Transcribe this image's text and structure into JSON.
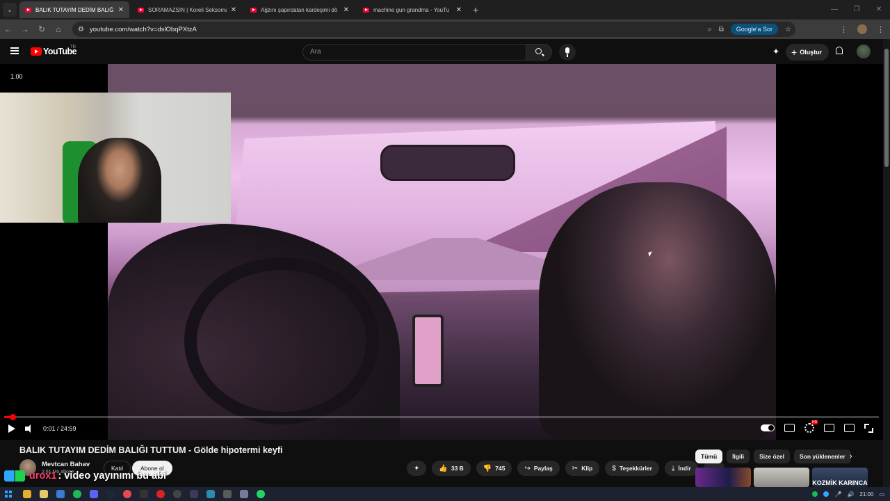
{
  "browser": {
    "tabs": [
      {
        "title": "BALIK TUTAYIM DEDİM BALIĞI",
        "active": true
      },
      {
        "title": "SORAMAZSIN | Koreli Seksoma",
        "active": false
      },
      {
        "title": "Ağzını şapırdatan kardeşimi dö",
        "active": false
      },
      {
        "title": "machine gun grandma - YouTu",
        "active": false
      }
    ],
    "url": "youtube.com/watch?v=dslObqPXtzA",
    "google_sor": "Google'a Sor"
  },
  "youtube": {
    "logo_text": "YouTube",
    "country": "TR",
    "search_placeholder": "Ara",
    "create_label": "Oluştur"
  },
  "player": {
    "speed": "1.00",
    "time": "0:01 / 24:59",
    "progress_fraction": 0.0007
  },
  "video": {
    "title": "BALIK TUTAYIM DEDİM BALIĞI TUTTUM - Gölde hipotermi keyfi",
    "channel": "Mevtcan Bahav",
    "subscribers": "2,61 Mn abone",
    "join_label": "Katıl",
    "subscribe_label": "Abone ol",
    "likes": "33 B",
    "dislikes": "745",
    "share_label": "Paylaş",
    "clip_label": "Klip",
    "thanks_label": "Teşekkürler",
    "download_label": "İndir"
  },
  "overlay": {
    "user": "urox1",
    "message": ": video yayınımı bu abi"
  },
  "chips": [
    "Tümü",
    "İlgili",
    "Size özel",
    "Son yüklenenler"
  ],
  "thumbnails": {
    "t3_text": "KOZMİK KARINCA"
  },
  "taskbar": {
    "clock": "21:00"
  },
  "colors": {
    "accent": "#ff0000",
    "background": "#0f0f0f"
  }
}
